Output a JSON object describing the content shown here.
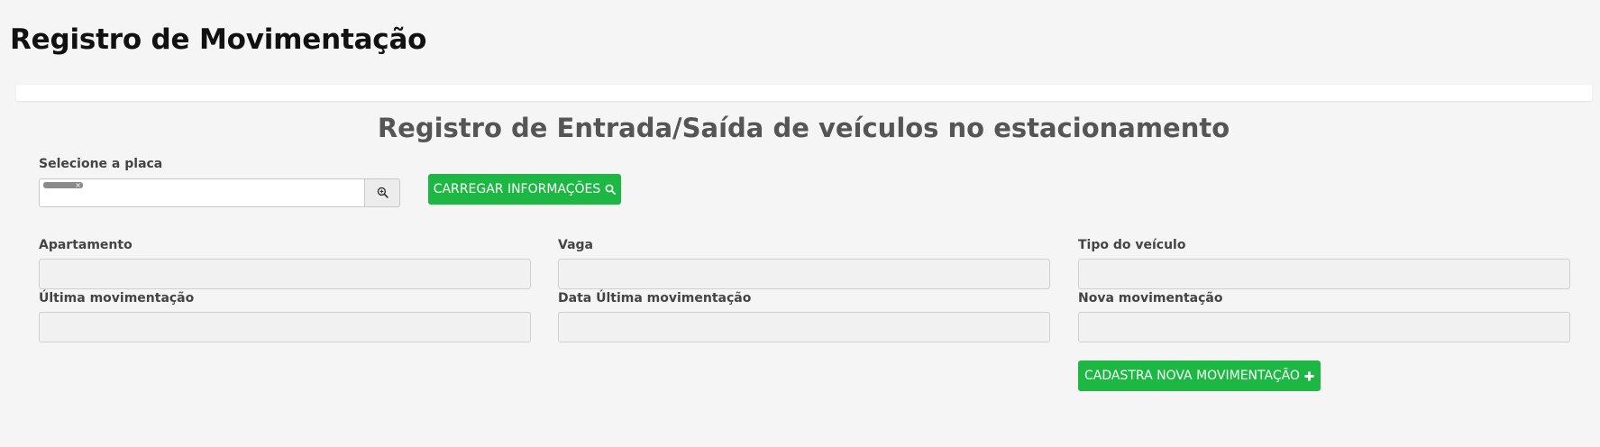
{
  "page": {
    "title": "Registro de Movimentação"
  },
  "section": {
    "title": "Registro de Entrada/Saída de veículos no estacionamento"
  },
  "plate": {
    "label": "Selecione a placa",
    "selected_chip_remove": "×",
    "search_icon": "zoom-in-icon"
  },
  "load_button": {
    "label": "CARREGAR INFORMAÇÕES",
    "icon": "search-icon"
  },
  "fields": {
    "apartamento": {
      "label": "Apartamento",
      "value": ""
    },
    "vaga": {
      "label": "Vaga",
      "value": ""
    },
    "tipo_veiculo": {
      "label": "Tipo do veículo",
      "value": ""
    },
    "ultima_movimentacao": {
      "label": "Última movimentação",
      "value": ""
    },
    "data_ultima_movimentacao": {
      "label": "Data Última movimentação",
      "value": ""
    },
    "nova_movimentacao": {
      "label": "Nova movimentação",
      "value": ""
    }
  },
  "register_button": {
    "label": "CADASTRA NOVA MOVIMENTAÇÃO",
    "icon": "plus-icon"
  },
  "colors": {
    "background": "#f5f5f5",
    "primary_green": "#1cb843",
    "title_text": "#111111",
    "section_title_text": "#555555"
  }
}
